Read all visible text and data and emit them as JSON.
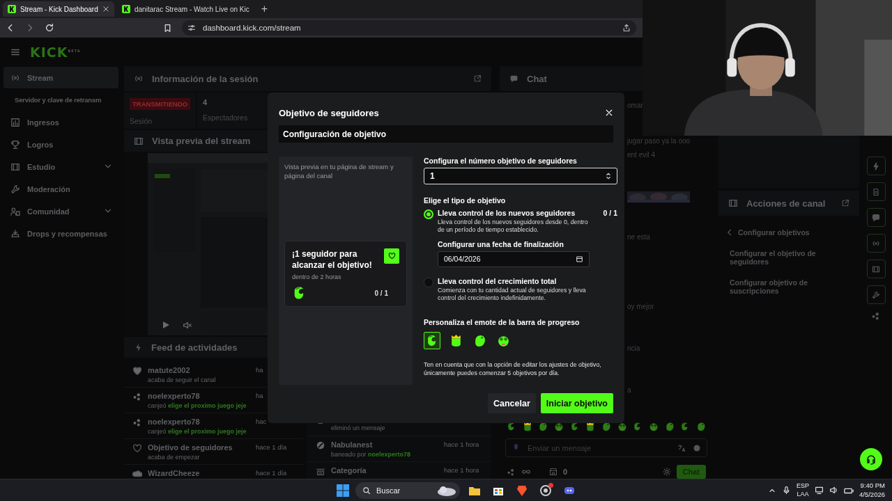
{
  "browser": {
    "tabs": [
      {
        "title": "Stream - Kick Dashboard",
        "selected": true
      },
      {
        "title": "danitarac Stream - Watch Live on Kic",
        "selected": false
      }
    ],
    "new_tab": "+",
    "address": "dashboard.kick.com/stream"
  },
  "sidebar": {
    "logo": "KICK",
    "logo_badge": "BETA",
    "items": [
      {
        "label": "Stream",
        "kind": "main",
        "selected": true,
        "has_submenu": false
      },
      {
        "label": "Servidor y clave de retransm",
        "kind": "sub",
        "selected": false,
        "has_submenu": false
      },
      {
        "label": "Ingresos",
        "kind": "main",
        "selected": false,
        "has_submenu": false
      },
      {
        "label": "Logros",
        "kind": "main",
        "selected": false,
        "has_submenu": false
      },
      {
        "label": "Estudio",
        "kind": "main",
        "selected": false,
        "has_submenu": true
      },
      {
        "label": "Moderación",
        "kind": "main",
        "selected": false,
        "has_submenu": false
      },
      {
        "label": "Comunidad",
        "kind": "main",
        "selected": false,
        "has_submenu": true
      },
      {
        "label": "Drops y recompensas",
        "kind": "main",
        "selected": false,
        "has_submenu": false
      }
    ]
  },
  "session": {
    "title": "Información de la sesión",
    "status": "TRANSMITIENDO",
    "status_label": "Sesión",
    "viewers": "4",
    "viewers_label": "Espectadores"
  },
  "preview": {
    "title": "Vista previa del stream"
  },
  "activity_feed": {
    "title": "Feed de actividades",
    "items": [
      {
        "name": "matute2002",
        "action": "acaba de seguir el canal",
        "time": "ha"
      },
      {
        "name": "noelexperto78",
        "action": "canjeó",
        "reward": "elige el proximo juego jeje",
        "time": "ha"
      },
      {
        "name": "noelexperto78",
        "action": "canjeó",
        "reward": "elige el proximo juego jeje",
        "time": "hac"
      },
      {
        "name": "Objetivo de seguidores",
        "action": "acaba de empezar",
        "time": "hace 1 día"
      },
      {
        "name": "WizardCheeze",
        "time": "hace 1 día"
      }
    ]
  },
  "moderation_feed": {
    "items": [
      {
        "action": "eliminó un mensaje"
      },
      {
        "name": "Nabulanest",
        "action": "baneado por",
        "reward": "noelexperto78",
        "time": "hace 1 hora"
      },
      {
        "name": "Categoría",
        "time": "hace 1 hora"
      }
    ]
  },
  "chat": {
    "title": "Chat",
    "messages": [
      {
        "kind": "text",
        "text": "omar"
      },
      {
        "kind": "text",
        "text": "jugar paso ya la ooo"
      },
      {
        "kind": "text",
        "text": "ent evil 4"
      },
      {
        "kind": "picture"
      },
      {
        "kind": "text",
        "text": "ne esta"
      },
      {
        "kind": "text",
        "text": "oy mejor"
      },
      {
        "kind": "text",
        "text": "ncia"
      },
      {
        "kind": "text",
        "text": "a"
      }
    ],
    "input": {
      "placeholder": "Enviar un mensaje"
    },
    "points": "0",
    "send": "Chat"
  },
  "channel_actions": {
    "title": "Acciones de canal",
    "back": "Configurar objetivos",
    "items": [
      "Configurar el objetivo de seguidores",
      "Configurar objetivo de suscripciones"
    ]
  },
  "modal": {
    "title": "Objetivo de seguidores",
    "section": "Configuración de objetivo",
    "preview": {
      "caption": "Vista previa en tu página de stream y página del canal",
      "card_title": "¡1 seguidor para alcanzar el objetivo!",
      "card_subtitle": "dentro de 2 horas",
      "progress": "0 / 1"
    },
    "target": {
      "label": "Configura el número objetivo de seguidores",
      "value": "1"
    },
    "type_label": "Elige el tipo de objetivo",
    "options": [
      {
        "title": "Lleva control de los nuevos seguidores",
        "description": "Lleva control de los nuevos seguidores desde 0, dentro de un período de tiempo establecido.",
        "count": "0 / 1",
        "selected": true,
        "date_label": "Configurar una fecha de finalización",
        "date_value": "06/04/2026"
      },
      {
        "title": "Lleva control del crecimiento total",
        "description": "Comienza con tu cantidad actual de seguidores y lleva control del crecimiento indefinidamente.",
        "selected": false
      }
    ],
    "emote_label": "Personaliza el emote de la barra de progreso",
    "emotes": [
      {
        "selected": true
      },
      {
        "selected": false
      },
      {
        "selected": false
      },
      {
        "selected": false
      }
    ],
    "note": "Ten en cuenta que con la opción de editar los ajustes de objetivo, únicamente puedes comenzar 5 objetivos por día.",
    "cancel": "Cancelar",
    "start": "Iniciar objetivo"
  },
  "taskbar": {
    "search": "Buscar",
    "language": "ESP",
    "layout": "LAA",
    "time": "9:40 PM",
    "date": "4/5/2026"
  }
}
